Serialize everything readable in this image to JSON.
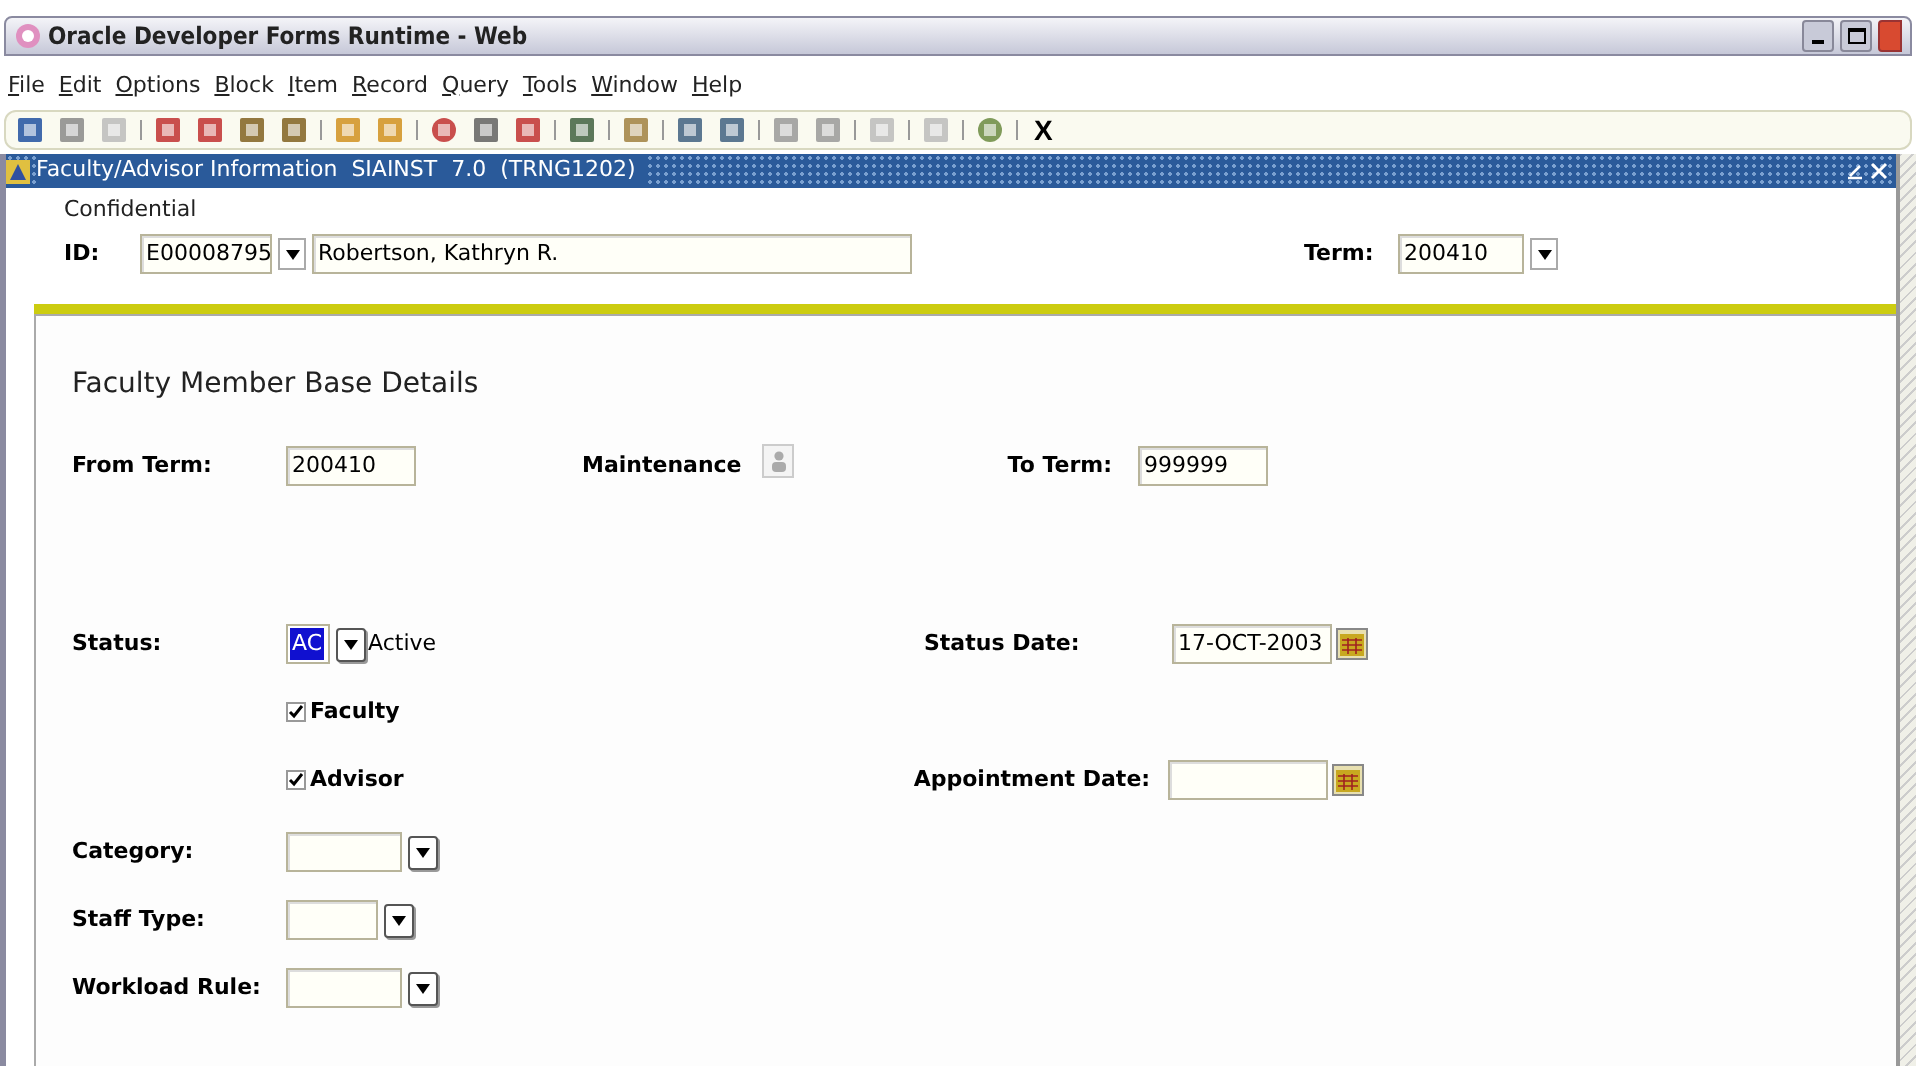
{
  "window": {
    "title": "Oracle Developer Forms Runtime - Web"
  },
  "menu": [
    "File",
    "Edit",
    "Options",
    "Block",
    "Item",
    "Record",
    "Query",
    "Tools",
    "Window",
    "Help"
  ],
  "toolbar": {
    "exit_label": "X"
  },
  "form": {
    "title": "Faculty/Advisor Information  SIAINST  7.0  (TRNG1202)",
    "confidential": "Confidential",
    "id_label": "ID:",
    "id_value": "E00008795",
    "name_value": "Robertson, Kathryn R.",
    "term_label": "Term:",
    "term_value": "200410",
    "heading": "Faculty Member Base Details",
    "from_term_label": "From Term:",
    "from_term_value": "200410",
    "maintenance_label": "Maintenance",
    "to_term_label": "To Term:",
    "to_term_value": "999999",
    "status_label": "Status:",
    "status_value": "AC",
    "status_highlighted": true,
    "status_desc": "Active",
    "status_date_label": "Status Date:",
    "status_date_value": "17-OCT-2003",
    "checkboxes": [
      {
        "label": "Faculty",
        "checked": true
      },
      {
        "label": "Advisor",
        "checked": true
      }
    ],
    "appointment_date_label": "Appointment Date:",
    "lists": [
      {
        "label": "Category:"
      },
      {
        "label": "Staff Type:"
      },
      {
        "label": "Workload Rule:"
      }
    ]
  }
}
